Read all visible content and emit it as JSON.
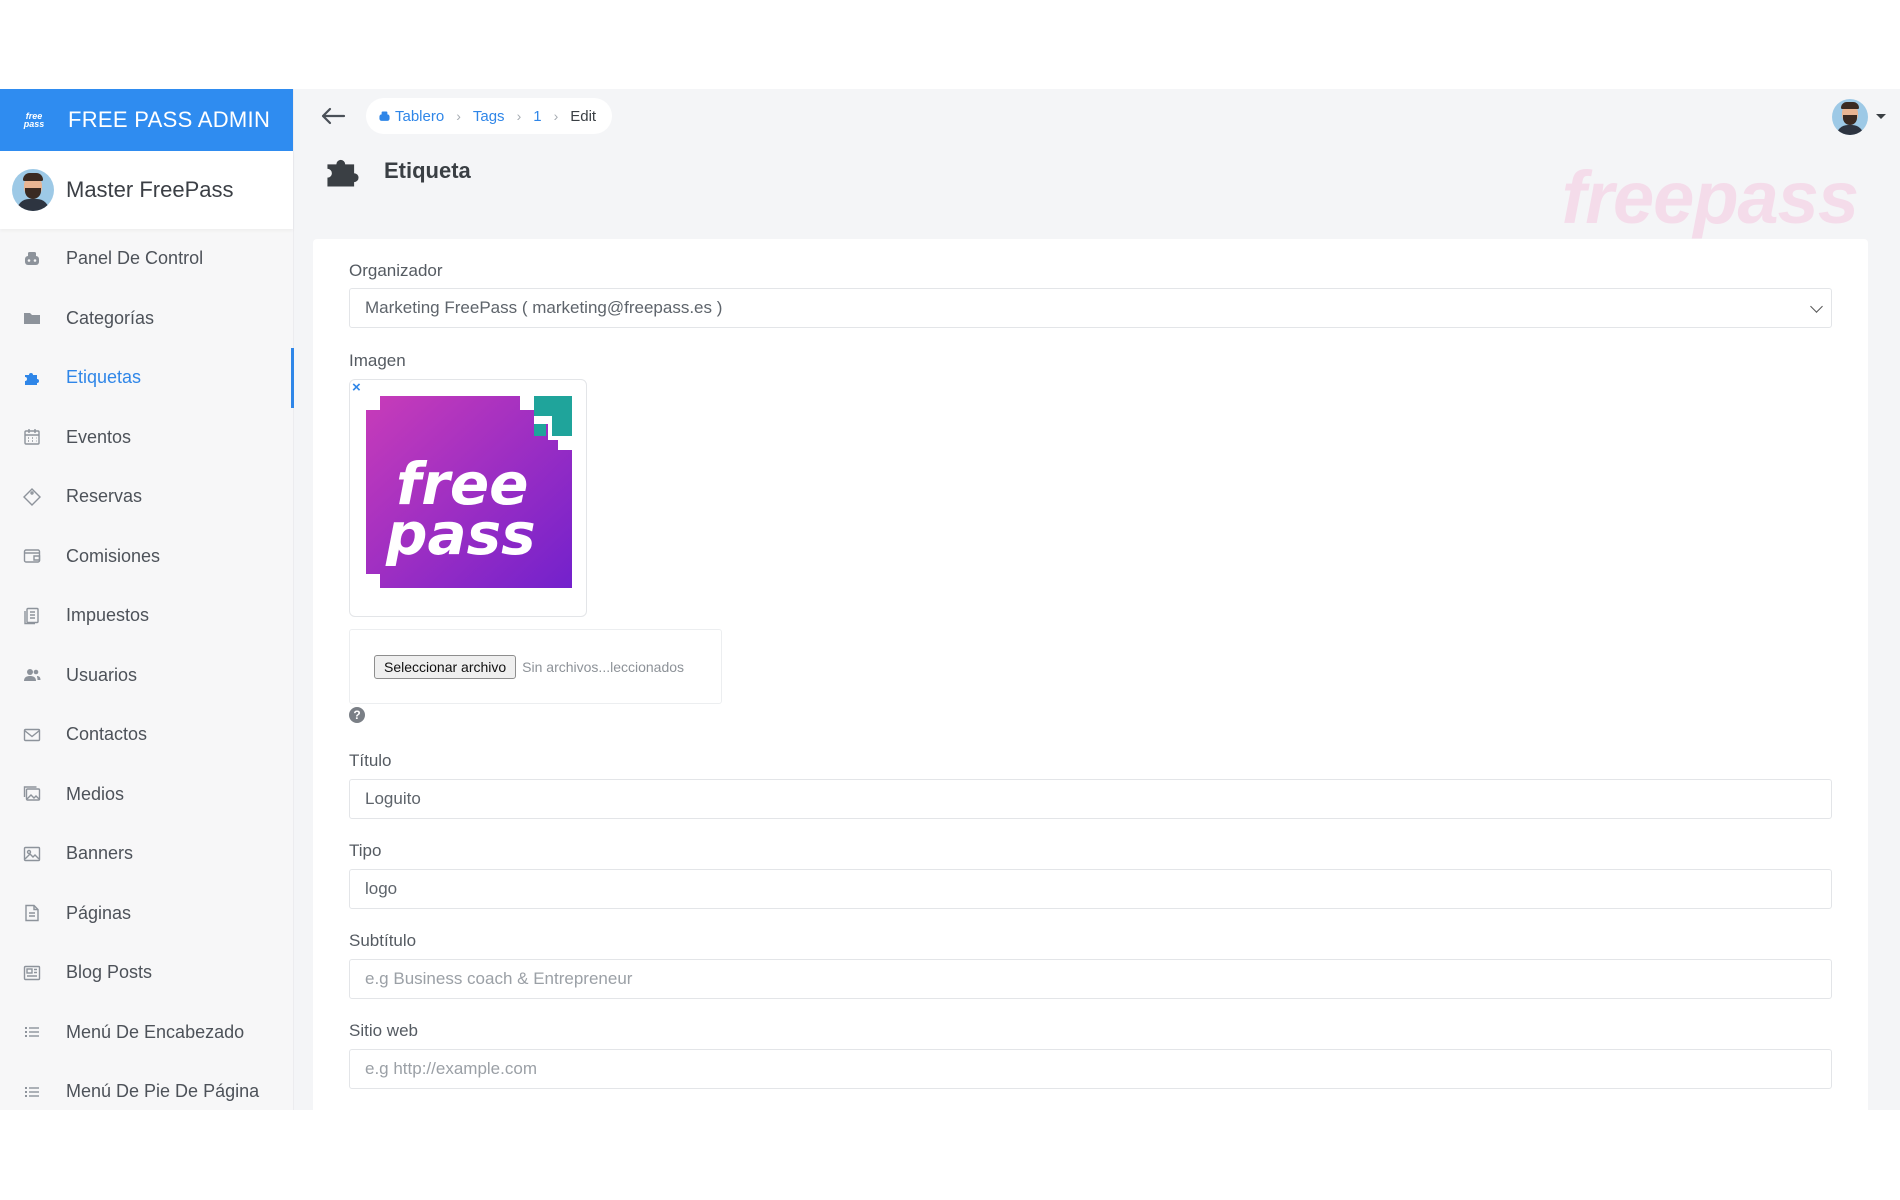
{
  "brand": {
    "title": "FREE PASS ADMIN",
    "logo_text": "free pass"
  },
  "user": {
    "name": "Master FreePass"
  },
  "sidebar": {
    "items": [
      {
        "label": "Panel De Control",
        "icon": "dashboard-icon"
      },
      {
        "label": "Categorías",
        "icon": "folder-icon"
      },
      {
        "label": "Etiquetas",
        "icon": "puzzle-icon",
        "active": true
      },
      {
        "label": "Eventos",
        "icon": "calendar-icon"
      },
      {
        "label": "Reservas",
        "icon": "ticket-icon"
      },
      {
        "label": "Comisiones",
        "icon": "wallet-icon"
      },
      {
        "label": "Impuestos",
        "icon": "document-icon"
      },
      {
        "label": "Usuarios",
        "icon": "users-icon"
      },
      {
        "label": "Contactos",
        "icon": "envelope-icon"
      },
      {
        "label": "Medios",
        "icon": "images-icon"
      },
      {
        "label": "Banners",
        "icon": "image-icon"
      },
      {
        "label": "Páginas",
        "icon": "page-icon"
      },
      {
        "label": "Blog Posts",
        "icon": "newspaper-icon"
      },
      {
        "label": "Menú De Encabezado",
        "icon": "list-icon"
      },
      {
        "label": "Menú De Pie De Página",
        "icon": "list-icon"
      }
    ]
  },
  "breadcrumb": {
    "home": "Tablero",
    "section": "Tags",
    "id": "1",
    "current": "Edit"
  },
  "page": {
    "title": "Etiqueta",
    "watermark": "freepass"
  },
  "form": {
    "organizer": {
      "label": "Organizador",
      "value": "Marketing FreePass ( marketing@freepass.es )"
    },
    "image": {
      "label": "Imagen",
      "remove": "×",
      "logo_line1": "free",
      "logo_line2": "pass",
      "file_button": "Seleccionar archivo",
      "file_status": "Sin archivos...leccionados",
      "help": "?"
    },
    "title": {
      "label": "Título",
      "value": "Loguito"
    },
    "type": {
      "label": "Tipo",
      "value": "logo"
    },
    "subtitle": {
      "label": "Subtítulo",
      "placeholder": "e.g Business coach & Entrepreneur"
    },
    "website": {
      "label": "Sitio web",
      "placeholder": "e.g http://example.com"
    }
  },
  "colors": {
    "accent": "#2f86e8",
    "brand_bar": "#2f8cf0",
    "logo_gradient_start": "#c33bb5",
    "logo_gradient_end": "#7a1fc9",
    "logo_teal": "#1fa49b"
  }
}
